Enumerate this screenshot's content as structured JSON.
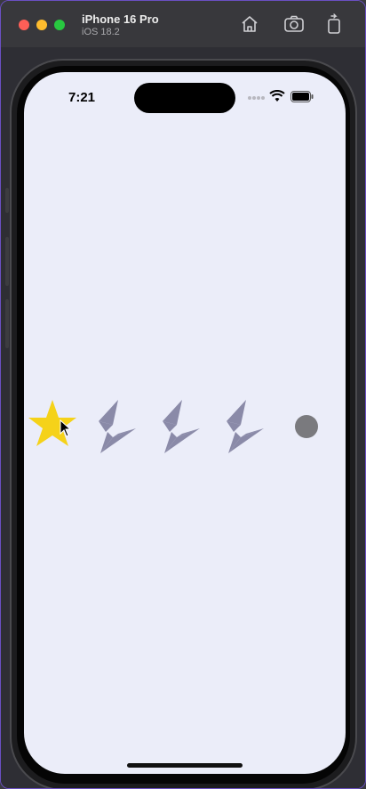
{
  "window": {
    "title": "iPhone 16 Pro",
    "subtitle": "iOS 18.2",
    "toolbar_icons": [
      "home-icon",
      "screenshot-icon",
      "rotate-icon"
    ]
  },
  "status_bar": {
    "time": "7:21",
    "icons": [
      "cellular-icon",
      "wifi-icon",
      "battery-icon"
    ]
  },
  "rating": {
    "max": 5,
    "value": 1,
    "filled_color": "#f5d219",
    "empty_color": "#8a8aa8",
    "thumb_color": "#7a7a7e"
  },
  "colors": {
    "screen_background": "#ebedf9",
    "window_border": "#6a4fc2"
  }
}
